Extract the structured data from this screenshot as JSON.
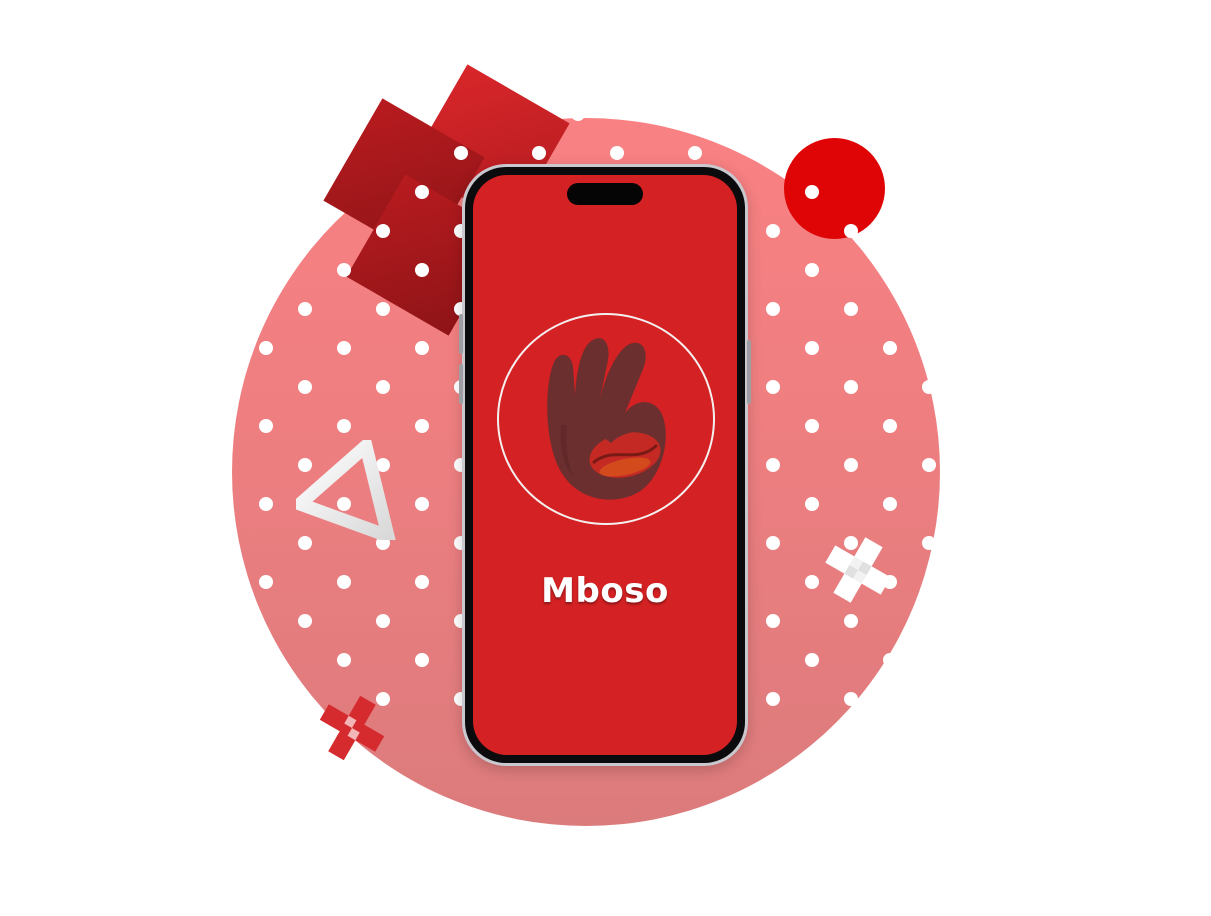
{
  "app": {
    "name": "Mboso",
    "logo": "hand-coffee-bean-icon"
  },
  "colors": {
    "screen_background": "#d42123",
    "backdrop_circle": "#f98183",
    "accent_ball": "#df0507",
    "hand": "#6b2f2f",
    "bean": "#c42a23"
  },
  "decorations": {
    "icons": [
      "triangle-outline-icon",
      "cross-pattern-icon",
      "cross-pattern-small-icon",
      "polka-dot-pattern"
    ]
  }
}
